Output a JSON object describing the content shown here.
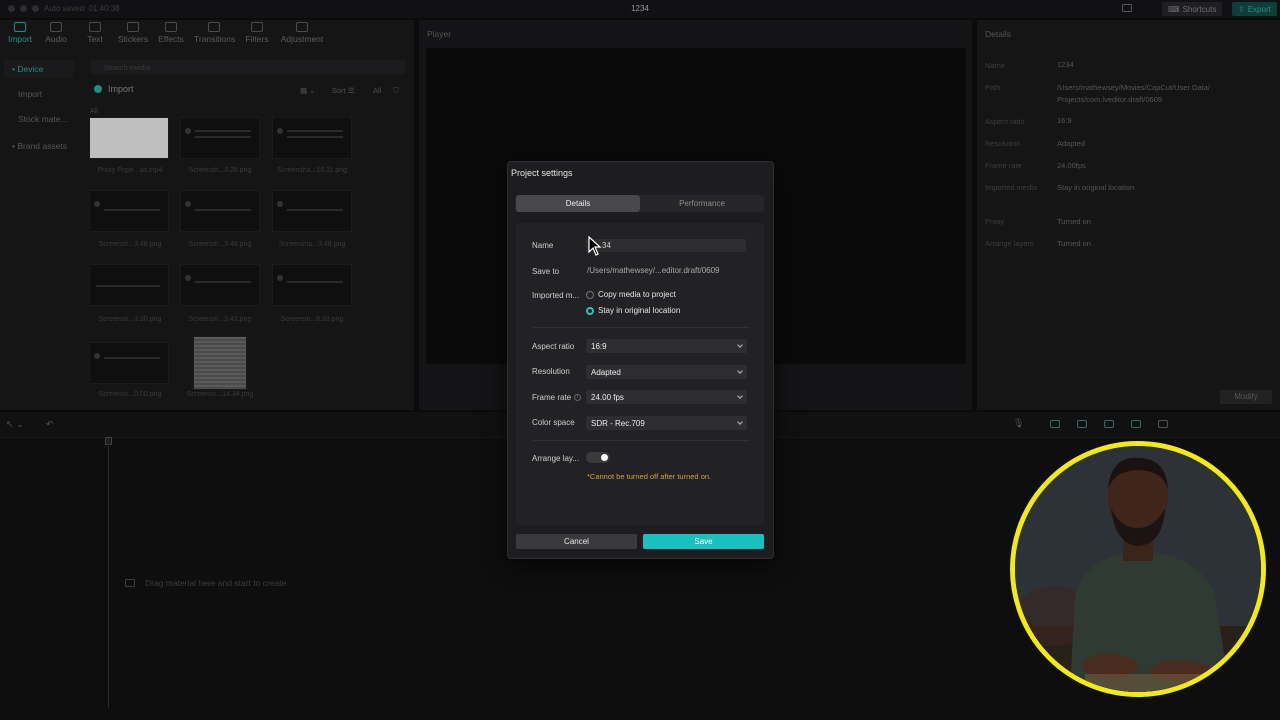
{
  "titlebar": {
    "title": "1234",
    "autosave": "Auto saved: 01:40:38",
    "shortcuts": "Shortcuts",
    "export": "Export"
  },
  "toolbar": {
    "tabs": [
      "Import",
      "Audio",
      "Text",
      "Stickers",
      "Effects",
      "Transitions",
      "Filters",
      "Adjustment"
    ]
  },
  "sidebar": {
    "items": [
      "• Device",
      "Import",
      "Stock mate...",
      "• Brand assets"
    ]
  },
  "media": {
    "search_placeholder": "Search media",
    "import_label": "Import",
    "sort_label": "Sort",
    "all_filter": "All",
    "all_label": "All",
    "thumbs": [
      "Proxy  Pope...sd.mp4",
      "Screensh...3.28.png",
      "Screensha...18.11.png",
      "Screensh...3.48.png",
      "Screensh...3.48.png",
      "Screensha...3.48.png",
      "Screensh...3.30.png",
      "Screensh...3.43.png",
      "Screensh...8.33.png",
      "Screensh...0.00.png",
      "Screensh...14.34.png"
    ]
  },
  "player": {
    "title": "Player"
  },
  "details": {
    "title": "Details",
    "rows": [
      {
        "label": "Name",
        "value": "1234"
      },
      {
        "label": "Path",
        "value": "/Users/mathewsey/Movies/CapCut/User Data/ Projects/com.lveditor.draft/0609"
      },
      {
        "label": "Aspect ratio",
        "value": "16:9"
      },
      {
        "label": "Resolution",
        "value": "Adapted"
      },
      {
        "label": "Frame rate",
        "value": "24.00fps"
      },
      {
        "label": "Imported media",
        "value": "Stay in original location"
      },
      {
        "label": "Proxy",
        "value": "Turned on"
      },
      {
        "label": "Arrange layers",
        "value": "Turned on"
      }
    ],
    "modify": "Modify"
  },
  "timeline": {
    "drag_hint": "Drag material here and start to create"
  },
  "modal": {
    "title": "Project settings",
    "tab_details": "Details",
    "tab_performance": "Performance",
    "name_label": "Name",
    "name_value": "34",
    "save_to_label": "Save to",
    "save_to_value": "/Users/mathewsey/...editor.draft/0609",
    "imported_label": "Imported m...",
    "opt_copy": "Copy media to project",
    "opt_stay": "Stay in original location",
    "aspect_label": "Aspect ratio",
    "aspect_value": "16:9",
    "resolution_label": "Resolution",
    "resolution_value": "Adapted",
    "framerate_label": "Frame rate",
    "framerate_value": "24.00 fps",
    "colorspace_label": "Color space",
    "colorspace_value": "SDR - Rec.709",
    "arrange_label": "Arrange lay...",
    "warning": "*Cannot be turned off after turned on.",
    "cancel": "Cancel",
    "save": "Save"
  }
}
